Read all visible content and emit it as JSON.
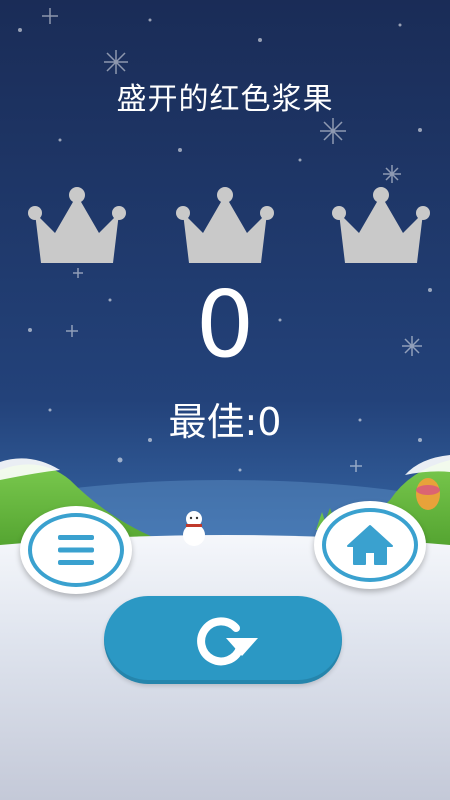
{
  "title": "盛开的红色浆果",
  "crowns": [
    {
      "icon": "crown-icon",
      "earned": false
    },
    {
      "icon": "crown-icon",
      "earned": false
    },
    {
      "icon": "crown-icon",
      "earned": false
    }
  ],
  "score": "0",
  "best": "最佳:0",
  "buttons": {
    "menu": {
      "icon": "menu-icon"
    },
    "home": {
      "icon": "home-icon"
    },
    "replay": {
      "icon": "replay-icon"
    }
  },
  "colors": {
    "sky_top": "#1a2d5a",
    "sky_bottom": "#2f5fa0",
    "crown_inactive": "#c9c9c9",
    "button_accent": "#3aa1cf",
    "replay_bg": "#2b98c4",
    "snow_ground": "#e9edf4"
  }
}
